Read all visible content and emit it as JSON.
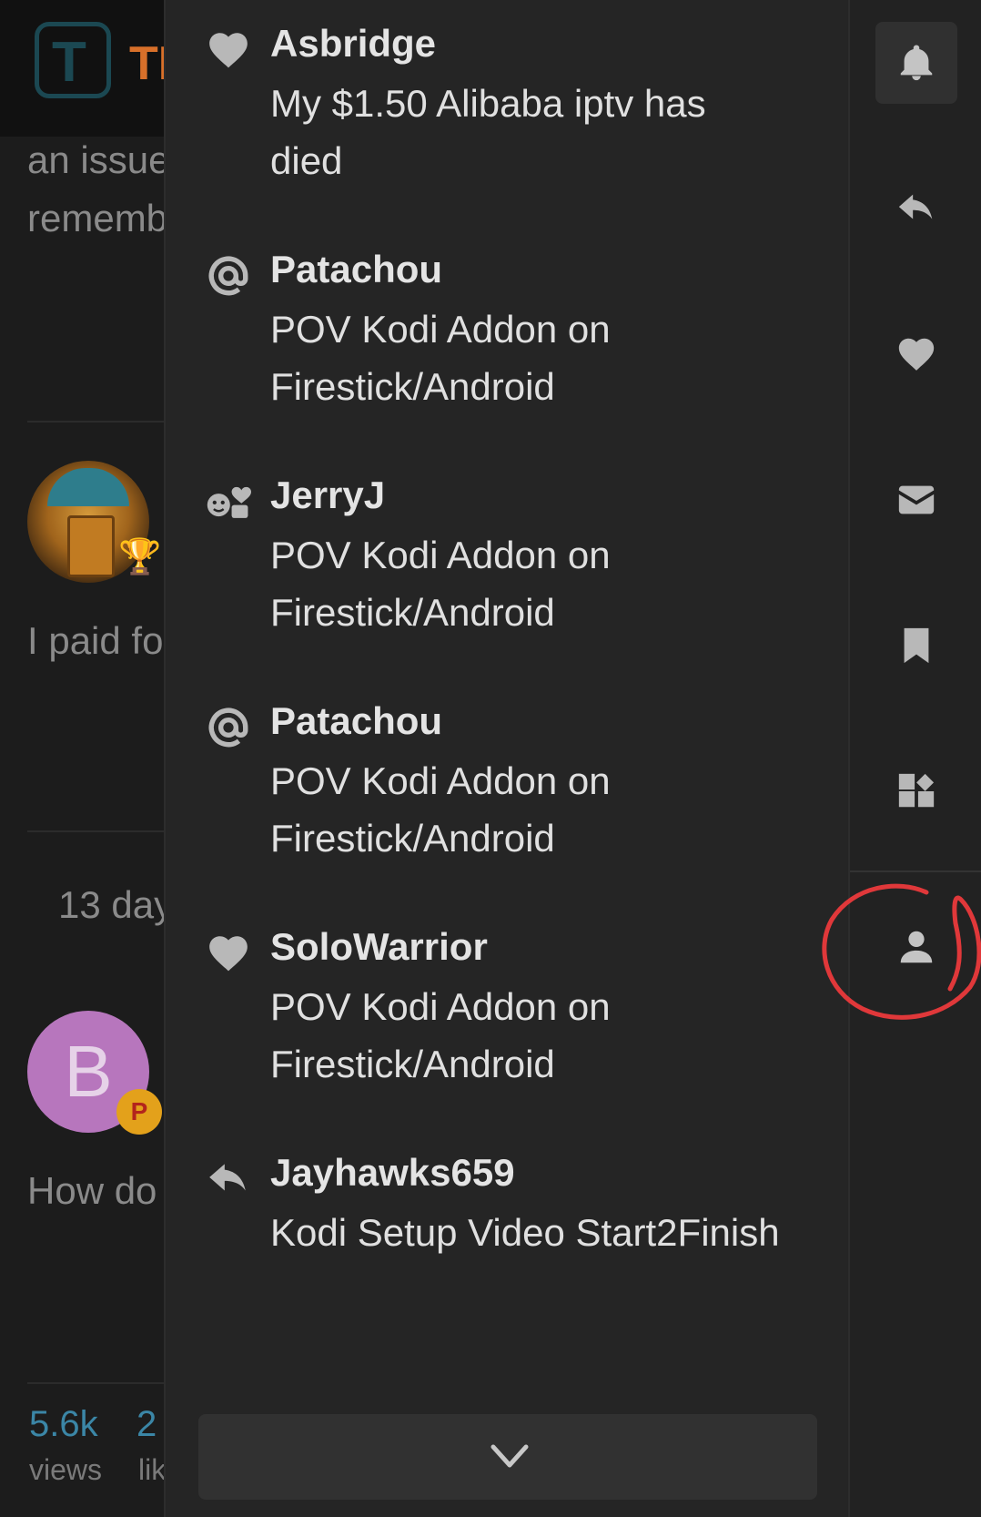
{
  "background_page": {
    "logo_text": "TI",
    "logo_letter": "T",
    "snippet_lines": [
      "an issue",
      "rememb"
    ],
    "post_text_1": "I paid fo",
    "time_text": "13 day",
    "avatar_letter": "B",
    "badge_letter": "P",
    "post_text_2": "How do",
    "stats": {
      "views_value": "5.6k",
      "views_label": "views",
      "likes_value": "2",
      "likes_label": "lik"
    }
  },
  "notifications": [
    {
      "icon": "heart-icon",
      "user": "Asbridge",
      "title": "My $1.50 Alibaba iptv has died"
    },
    {
      "icon": "at-mention-icon",
      "user": "Patachou",
      "title": "POV Kodi Addon on Firestick/Android"
    },
    {
      "icon": "reaction-icon",
      "user": "JerryJ",
      "title": "POV Kodi Addon on Firestick/Android"
    },
    {
      "icon": "at-mention-icon",
      "user": "Patachou",
      "title": "POV Kodi Addon on Firestick/Android"
    },
    {
      "icon": "heart-icon",
      "user": "SoloWarrior",
      "title": "POV Kodi Addon on Firestick/Android"
    },
    {
      "icon": "reply-icon",
      "user": "Jayhawks659",
      "title": "Kodi Setup Video Start2Finish"
    }
  ],
  "rail": {
    "items": [
      "bell-icon",
      "reply-icon",
      "heart-icon",
      "envelope-icon",
      "bookmark-icon",
      "widgets-icon",
      "user-icon"
    ],
    "active": "bell-icon",
    "annotation_color": "#e0383a"
  },
  "colors": {
    "panel_bg": "#252525",
    "accent_link": "#3b86a6",
    "logo_orange": "#d8702a"
  }
}
